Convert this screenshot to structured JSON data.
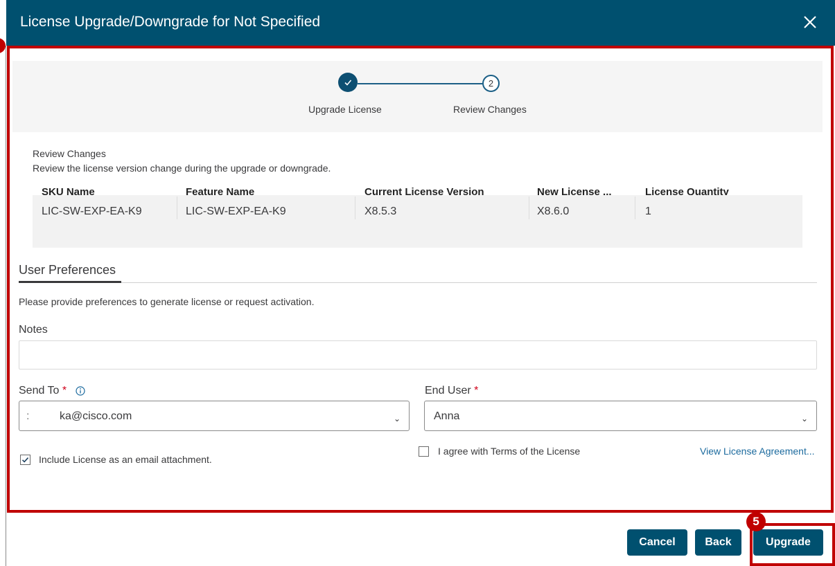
{
  "dialog": {
    "title": "License Upgrade/Downgrade for Not Specified"
  },
  "stepper": {
    "steps": [
      {
        "label": "Upgrade License"
      },
      {
        "label": "Review Changes",
        "number": "2"
      }
    ]
  },
  "review": {
    "title": "Review Changes",
    "description": "Review the license version change during the upgrade or downgrade.",
    "columns": [
      "SKU Name",
      "Feature Name",
      "Current License Version",
      "New License ...",
      "License Quantity"
    ],
    "rows": [
      [
        "LIC-SW-EXP-EA-K9",
        "LIC-SW-EXP-EA-K9",
        "X8.5.3",
        "X8.6.0",
        "1"
      ]
    ]
  },
  "preferences": {
    "tab_label": "User Preferences",
    "hint": "Please provide preferences to generate license or request activation.",
    "notes_label": "Notes",
    "notes_value": "",
    "send_to_label": "Send To",
    "send_to_value": "ka@cisco.com",
    "end_user_label": "End User",
    "end_user_value": "Anna",
    "required_mark": "*",
    "include_attachment_label": "Include License as an email attachment.",
    "include_attachment_checked": true,
    "agree_terms_label": "I agree with Terms of the License",
    "agree_terms_checked": false,
    "view_agreement_link": "View License Agreement..."
  },
  "footer": {
    "cancel_label": "Cancel",
    "back_label": "Back",
    "upgrade_label": "Upgrade"
  },
  "annotations": {
    "step5_badge": "5"
  },
  "colors": {
    "header": "#00506f",
    "primary_button": "#00506f",
    "highlight": "#c00000",
    "link": "#1b6a9e",
    "required": "#d0021b"
  }
}
